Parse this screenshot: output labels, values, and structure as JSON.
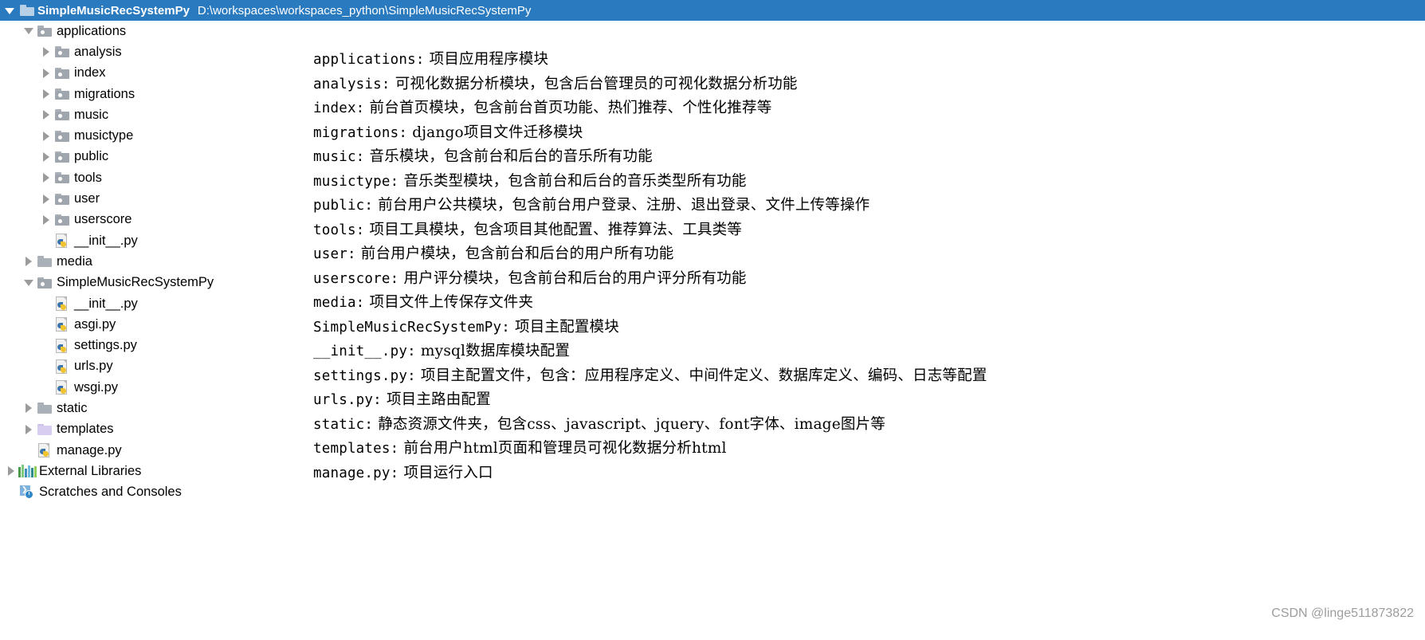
{
  "title_bar": {
    "expand_icon": "triangle-down-icon",
    "folder_icon": "folder-icon",
    "project_name": "SimpleMusicRecSystemPy",
    "project_path": "D:\\workspaces\\workspaces_python\\SimpleMusicRecSystemPy",
    "background_color": "#2a7ac0",
    "text_color": "#ffffff"
  },
  "tree": {
    "items": [
      {
        "label": "applications",
        "indent": 1,
        "arrow": "expanded",
        "icon": "folder-source-icon"
      },
      {
        "label": "analysis",
        "indent": 2,
        "arrow": "collapsed",
        "icon": "folder-source-icon"
      },
      {
        "label": "index",
        "indent": 2,
        "arrow": "collapsed",
        "icon": "folder-source-icon"
      },
      {
        "label": "migrations",
        "indent": 2,
        "arrow": "collapsed",
        "icon": "folder-source-icon"
      },
      {
        "label": "music",
        "indent": 2,
        "arrow": "collapsed",
        "icon": "folder-source-icon"
      },
      {
        "label": "musictype",
        "indent": 2,
        "arrow": "collapsed",
        "icon": "folder-source-icon"
      },
      {
        "label": "public",
        "indent": 2,
        "arrow": "collapsed",
        "icon": "folder-source-icon"
      },
      {
        "label": "tools",
        "indent": 2,
        "arrow": "collapsed",
        "icon": "folder-source-icon"
      },
      {
        "label": "user",
        "indent": 2,
        "arrow": "collapsed",
        "icon": "folder-source-icon"
      },
      {
        "label": "userscore",
        "indent": 2,
        "arrow": "collapsed",
        "icon": "folder-source-icon"
      },
      {
        "label": "__init__.py",
        "indent": 2,
        "arrow": "none",
        "icon": "python-file-icon"
      },
      {
        "label": "media",
        "indent": 1,
        "arrow": "collapsed",
        "icon": "folder-icon"
      },
      {
        "label": "SimpleMusicRecSystemPy",
        "indent": 1,
        "arrow": "expanded",
        "icon": "folder-source-icon"
      },
      {
        "label": "__init__.py",
        "indent": 2,
        "arrow": "none",
        "icon": "python-file-icon"
      },
      {
        "label": "asgi.py",
        "indent": 2,
        "arrow": "none",
        "icon": "python-file-icon"
      },
      {
        "label": "settings.py",
        "indent": 2,
        "arrow": "none",
        "icon": "python-file-icon"
      },
      {
        "label": "urls.py",
        "indent": 2,
        "arrow": "none",
        "icon": "python-file-icon"
      },
      {
        "label": "wsgi.py",
        "indent": 2,
        "arrow": "none",
        "icon": "python-file-icon"
      },
      {
        "label": "static",
        "indent": 1,
        "arrow": "collapsed",
        "icon": "folder-icon"
      },
      {
        "label": "templates",
        "indent": 1,
        "arrow": "collapsed",
        "icon": "folder-template-icon"
      },
      {
        "label": "manage.py",
        "indent": 1,
        "arrow": "none",
        "icon": "python-file-icon"
      },
      {
        "label": "External Libraries",
        "indent": 0,
        "arrow": "collapsed",
        "icon": "external-libraries-icon"
      },
      {
        "label": "Scratches and Consoles",
        "indent": 0,
        "arrow": "none",
        "icon": "scratches-icon"
      }
    ]
  },
  "description": {
    "lines": [
      {
        "key": "applications:",
        "text": " 项目应用程序模块"
      },
      {
        "key": "analysis:",
        "text": " 可视化数据分析模块，包含后台管理员的可视化数据分析功能"
      },
      {
        "key": "index:",
        "text": " 前台首页模块，包含前台首页功能、热们推荐、个性化推荐等"
      },
      {
        "key": "migrations:",
        "text": " django项目文件迁移模块"
      },
      {
        "key": "music:",
        "text": " 音乐模块，包含前台和后台的音乐所有功能"
      },
      {
        "key": "musictype:",
        "text": " 音乐类型模块，包含前台和后台的音乐类型所有功能"
      },
      {
        "key": "public:",
        "text": " 前台用户公共模块，包含前台用户登录、注册、退出登录、文件上传等操作"
      },
      {
        "key": "tools:",
        "text": " 项目工具模块，包含项目其他配置、推荐算法、工具类等"
      },
      {
        "key": "user:",
        "text": " 前台用户模块，包含前台和后台的用户所有功能"
      },
      {
        "key": "userscore:",
        "text": " 用户评分模块，包含前台和后台的用户评分所有功能"
      },
      {
        "key": "media:",
        "text": " 项目文件上传保存文件夹"
      },
      {
        "key": "SimpleMusicRecSystemPy:",
        "text": " 项目主配置模块"
      },
      {
        "key": "__init__.py:",
        "text": " mysql数据库模块配置"
      },
      {
        "key": "settings.py:",
        "text": " 项目主配置文件，包含：应用程序定义、中间件定义、数据库定义、编码、日志等配置"
      },
      {
        "key": "urls.py:",
        "text": " 项目主路由配置"
      },
      {
        "key": "static:",
        "text": " 静态资源文件夹，包含css、javascript、jquery、font字体、image图片等"
      },
      {
        "key": "templates:",
        "text": " 前台用户html页面和管理员可视化数据分析html"
      },
      {
        "key": "manage.py:",
        "text": " 项目运行入口"
      }
    ]
  },
  "watermark": {
    "text": "CSDN @linge511873822",
    "color": "#9d9d9d"
  },
  "colors": {
    "accent": "#2a7ac0",
    "folder_gray": "#a9b0b7",
    "folder_template": "#d7cdf0",
    "python_blue": "#3c76ad",
    "python_yellow": "#f0c330",
    "arrow_gray": "#9b9b9b"
  }
}
